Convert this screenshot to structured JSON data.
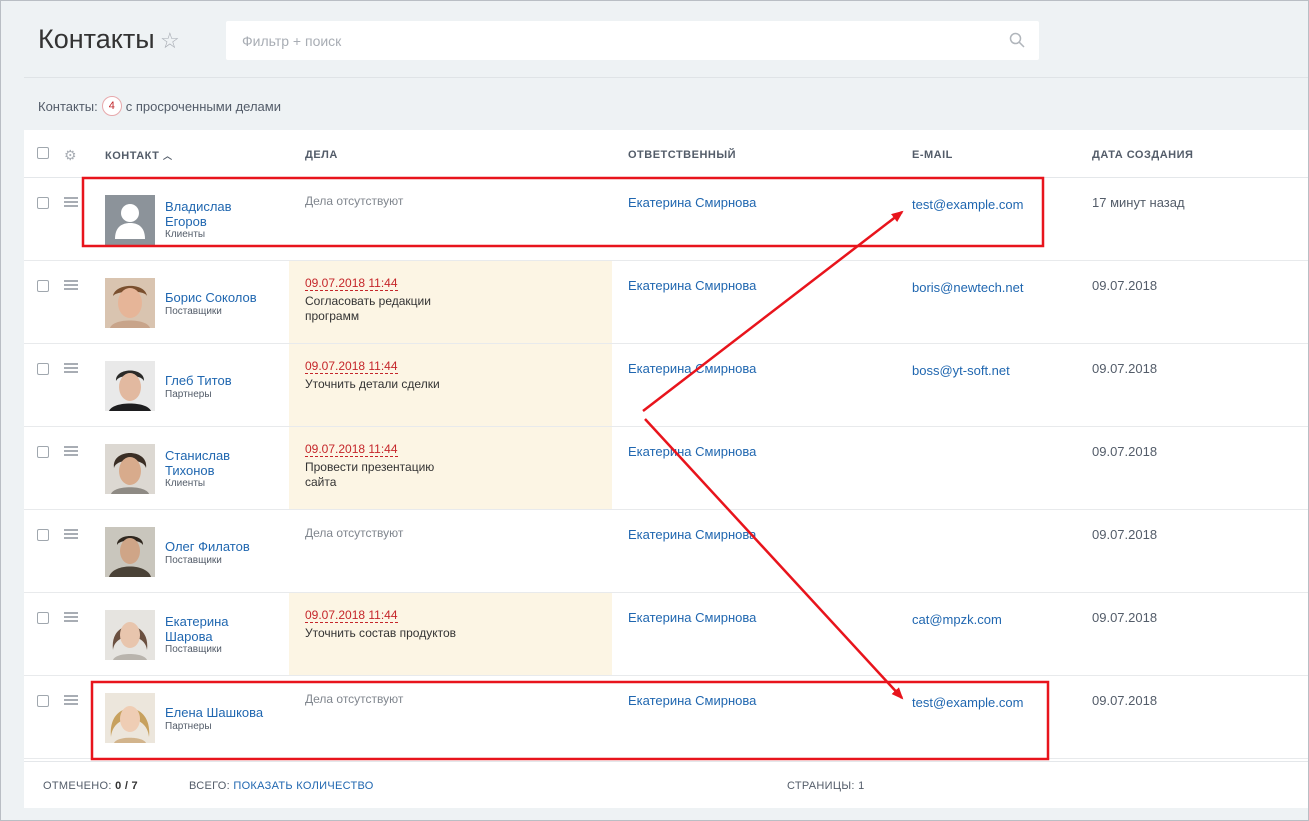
{
  "header": {
    "title": "Контакты",
    "search_placeholder": "Фильтр + поиск"
  },
  "counter": {
    "label": "Контакты:",
    "count": "4",
    "suffix": "с просроченными делами"
  },
  "columns": {
    "contact": "КОНТАКТ",
    "deals": "ДЕЛА",
    "responsible": "ОТВЕТСТВЕННЫЙ",
    "email": "E-MAIL",
    "created": "ДАТА СОЗДАНИЯ"
  },
  "rows": [
    {
      "name": "Владислав Егоров",
      "type": "Клиенты",
      "avatar": "default-user",
      "deal_date": "",
      "deal_text": "",
      "deal_none": "Дела отсутствуют",
      "responsible": "Екатерина Смирнова",
      "email": "test@example.com",
      "created": "17 минут назад"
    },
    {
      "name": "Борис Соколов",
      "type": "Поставщики",
      "avatar": "photo",
      "deal_date": "09.07.2018 11:44",
      "deal_text": "Согласовать редакции программ",
      "deal_none": "",
      "responsible": "Екатерина Смирнова",
      "email": "boris@newtech.net",
      "created": "09.07.2018"
    },
    {
      "name": "Глеб Титов",
      "type": "Партнеры",
      "avatar": "photo",
      "deal_date": "09.07.2018 11:44",
      "deal_text": "Уточнить детали сделки",
      "deal_none": "",
      "responsible": "Екатерина Смирнова",
      "email": "boss@yt-soft.net",
      "created": "09.07.2018"
    },
    {
      "name": "Станислав Тихонов",
      "type": "Клиенты",
      "avatar": "photo",
      "deal_date": "09.07.2018 11:44",
      "deal_text": "Провести презентацию сайта",
      "deal_none": "",
      "responsible": "Екатерина Смирнова",
      "email": "",
      "created": "09.07.2018"
    },
    {
      "name": "Олег Филатов",
      "type": "Поставщики",
      "avatar": "photo",
      "deal_date": "",
      "deal_text": "",
      "deal_none": "Дела отсутствуют",
      "responsible": "Екатерина Смирнова",
      "email": "",
      "created": "09.07.2018"
    },
    {
      "name": "Екатерина Шарова",
      "type": "Поставщики",
      "avatar": "photo",
      "deal_date": "09.07.2018 11:44",
      "deal_text": "Уточнить состав продуктов",
      "deal_none": "",
      "responsible": "Екатерина Смирнова",
      "email": "cat@mpzk.com",
      "created": "09.07.2018"
    },
    {
      "name": "Елена Шашкова",
      "type": "Партнеры",
      "avatar": "photo",
      "deal_date": "",
      "deal_text": "",
      "deal_none": "Дела отсутствуют",
      "responsible": "Екатерина Смирнова",
      "email": "test@example.com",
      "created": "09.07.2018"
    }
  ],
  "footer": {
    "checked_label": "ОТМЕЧЕНО:",
    "checked_value": "0 / 7",
    "total_label": "ВСЕГО:",
    "total_link": "ПОКАЗАТЬ КОЛИЧЕСТВО",
    "pages_label": "СТРАНИЦЫ:",
    "pages_value": "1"
  },
  "colors": {
    "link": "#2067b0",
    "overdue": "#c5262a",
    "deal_highlight": "#fcf5e4",
    "annotation": "#e8141c"
  }
}
